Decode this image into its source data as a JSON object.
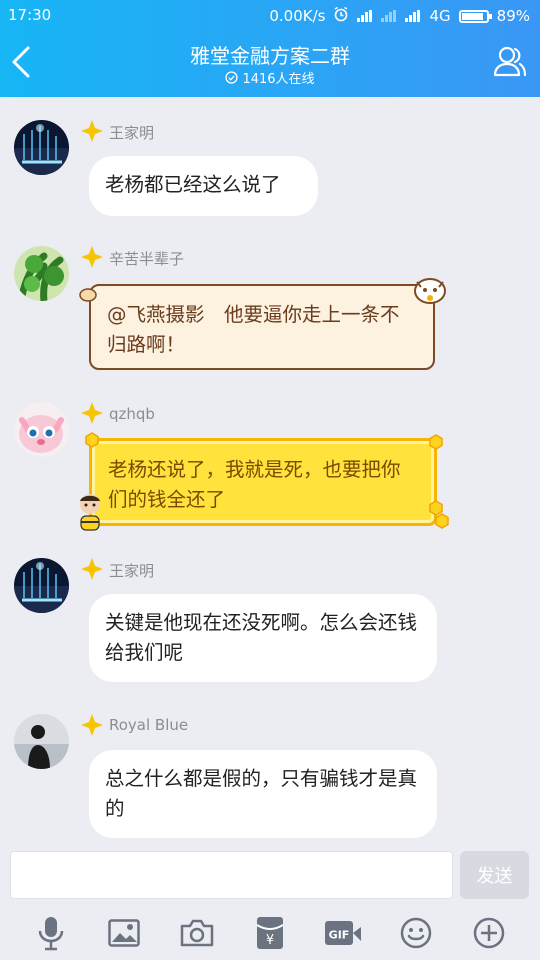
{
  "status": {
    "time": "17:30",
    "speed": "0.00K/s",
    "network": "4G",
    "battery": "89%",
    "battery_level": 0.89
  },
  "header": {
    "title": "雅堂金融方案二群",
    "online": "1416人在线"
  },
  "messages": [
    {
      "name": "王家明",
      "text": "老杨都已经这么说了",
      "style": "default",
      "avatar": "fountain-night-avatar"
    },
    {
      "name": "辛苦半辈子",
      "text": "@飞燕摄影　他要逼你走上一条不归路啊！",
      "style": "cat",
      "avatar": "green-plant-avatar"
    },
    {
      "name": "qzhqb",
      "text": "老杨还说了，我就是死，也要把你们的钱全还了",
      "style": "honey",
      "avatar": "pink-cat-avatar"
    },
    {
      "name": "王家明",
      "text": "关键是他现在还没死啊。怎么会还钱给我们呢",
      "style": "default",
      "avatar": "fountain-night-avatar"
    },
    {
      "name": "Royal Blue",
      "text": "总之什么都是假的，只有骗钱才是真的",
      "style": "default",
      "avatar": "silhouette-avatar"
    }
  ],
  "composer": {
    "send_label": "发送"
  },
  "toolbar": {
    "items": [
      "mic-icon",
      "image-icon",
      "camera-icon",
      "red-packet-icon",
      "gif-icon",
      "emoji-icon",
      "plus-icon"
    ]
  },
  "colors": {
    "header_start": "#17b6f5",
    "header_end": "#3a97f5",
    "badge": "#f7c400"
  }
}
